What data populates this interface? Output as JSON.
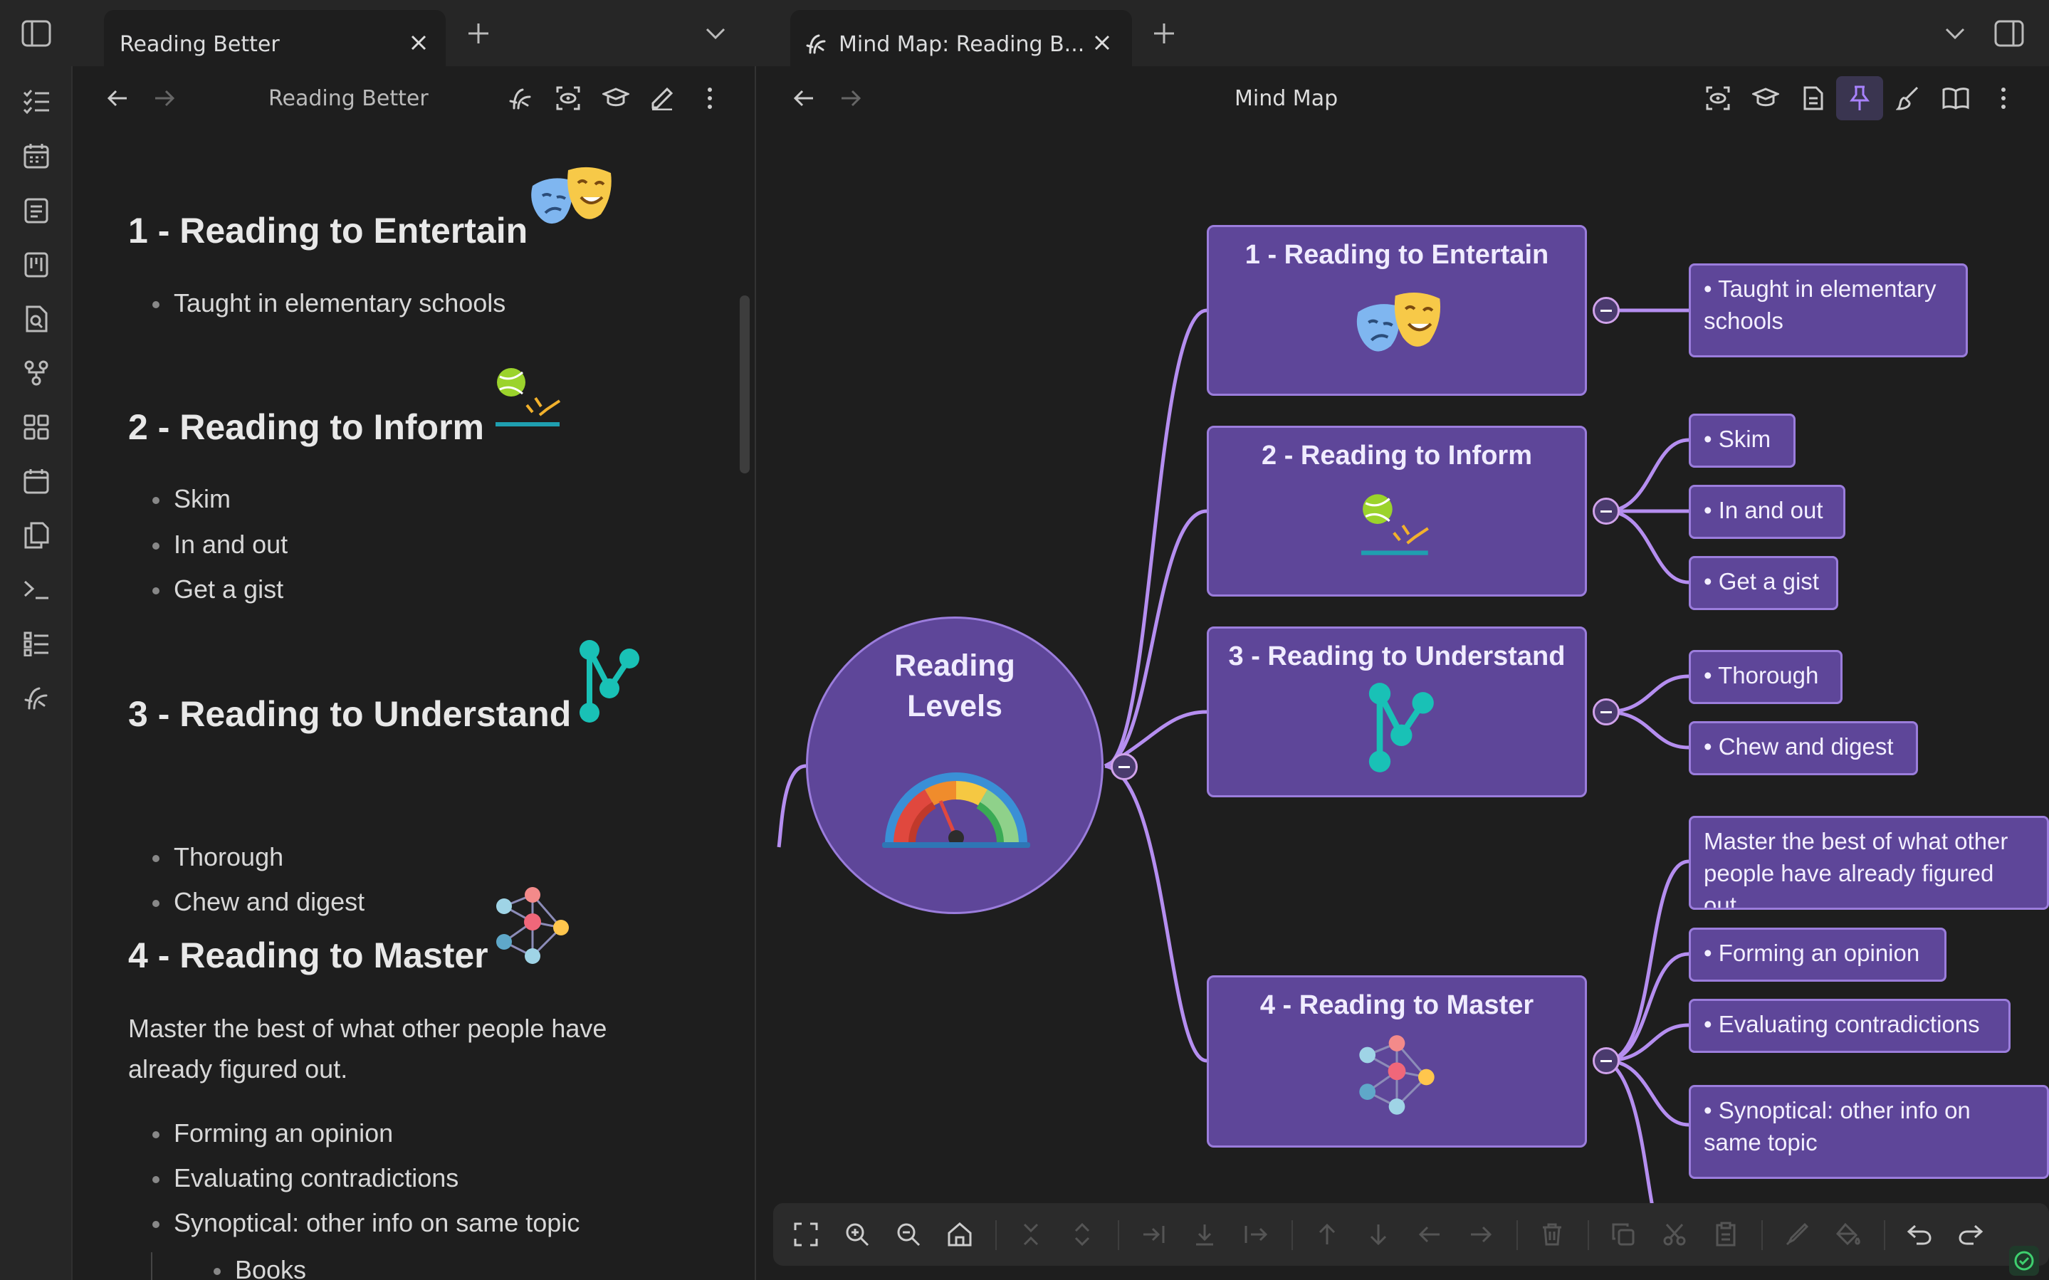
{
  "tabs": {
    "left": {
      "title": "Reading Better"
    },
    "right": {
      "title": "Mind Map: Reading B..."
    }
  },
  "left_pane": {
    "header_title": "Reading Better",
    "sections": [
      {
        "heading": "1 - Reading to Entertain",
        "items": [
          "Taught in elementary schools"
        ]
      },
      {
        "heading": "2 - Reading to Inform",
        "items": [
          "Skim",
          "In and out",
          "Get a gist"
        ]
      },
      {
        "heading": "3 - Reading to Understand",
        "items": [
          "Thorough",
          "Chew and digest"
        ]
      },
      {
        "heading": "4 - Reading to Master",
        "paragraph": "Master the best of what other people have already figured out.",
        "items": [
          "Forming an opinion",
          "Evaluating contradictions",
          "Synoptical: other info on same topic"
        ],
        "sub_items": [
          "Books"
        ]
      }
    ]
  },
  "right_pane": {
    "header_title": "Mind Map",
    "root": {
      "title": "Reading\nLevels",
      "icon": "gauge-icon"
    },
    "branches": [
      {
        "title": "1 - Reading to Entertain",
        "icon": "theater-masks-icon",
        "leaves": [
          "• Taught in elementary schools"
        ]
      },
      {
        "title": "2 - Reading to Inform",
        "icon": "ball-bounce-icon",
        "leaves": [
          "• Skim",
          "• In and out",
          "• Get a gist"
        ]
      },
      {
        "title": "3 - Reading to Understand",
        "icon": "branch-nodes-icon",
        "leaves": [
          "• Thorough",
          "• Chew and digest"
        ]
      },
      {
        "title": "4 - Reading to Master",
        "icon": "network-icon",
        "leaves": [
          "Master the best of what other people have already figured out.",
          "• Forming an opinion",
          "• Evaluating contradictions",
          "• Synoptical: other info on same topic"
        ]
      }
    ]
  },
  "colors": {
    "node_fill": "#5e4699",
    "node_border": "#9b7ddc",
    "branch_line": "#b58ef0",
    "background": "#1e1e1e",
    "tab_bar": "#262626",
    "pin_accent": "#a882ff"
  }
}
